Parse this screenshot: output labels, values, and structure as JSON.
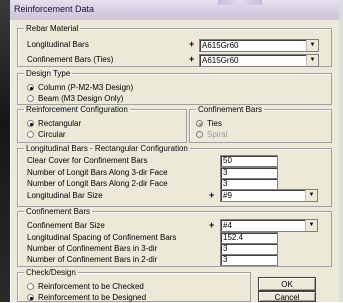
{
  "window": {
    "title": "Reinforcement Data"
  },
  "rebar_material": {
    "legend": "Rebar Material",
    "longitudinal": {
      "label": "Longitudinal Bars",
      "plus": "+",
      "value": "A615Gr60"
    },
    "confinement": {
      "label": "Confinement Bars (Ties)",
      "plus": "+",
      "value": "A615Gr60"
    }
  },
  "design_type": {
    "legend": "Design Type",
    "options": [
      {
        "label": "Column  (P-M2-M3 Design)",
        "selected": true
      },
      {
        "label": "Beam  (M3 Design Only)",
        "selected": false
      }
    ]
  },
  "reinforcement_configuration": {
    "legend": "Reinforcement Configuration",
    "options": [
      {
        "label": "Rectangular",
        "selected": true
      },
      {
        "label": "Circular",
        "selected": false
      }
    ]
  },
  "confinement_bars_type": {
    "legend": "Confinement Bars",
    "options": [
      {
        "label": "Ties",
        "selected": true,
        "enabled": false
      },
      {
        "label": "Spiral",
        "selected": false,
        "enabled": false
      }
    ]
  },
  "longitudinal_rect": {
    "legend": "Longitudinal Bars - Rectangular Configuration",
    "clear_cover": {
      "label": "Clear Cover for Confinement Bars",
      "value": "50"
    },
    "along_3dir": {
      "label": "Number of Longit Bars Along 3-dir Face",
      "value": "3"
    },
    "along_2dir": {
      "label": "Number of Longit Bars Along 2-dir Face",
      "value": "3"
    },
    "bar_size": {
      "label": "Longitudinal Bar Size",
      "plus": "+",
      "value": "#9"
    }
  },
  "confinement_bars": {
    "legend": "Confinement Bars",
    "bar_size": {
      "label": "Confinement Bar Size",
      "plus": "+",
      "value": "#4"
    },
    "spacing": {
      "label": "Longitudinal Spacing of Confinement Bars",
      "value": "152.4"
    },
    "num_3dir": {
      "label": "Number of Confinement Bars in 3-dir",
      "value": "3"
    },
    "num_2dir": {
      "label": "Number of Confinement Bars in 2-dir",
      "value": "3"
    }
  },
  "check_design": {
    "legend": "Check/Design",
    "options": [
      {
        "label": "Reinforcement to be Checked",
        "selected": false
      },
      {
        "label": "Reinforcement to be Designed",
        "selected": true
      }
    ]
  },
  "buttons": {
    "ok": "OK",
    "cancel": "Cancel"
  },
  "icons": {
    "dropdown": "chevron-down-icon",
    "radio": "radio-icon"
  }
}
